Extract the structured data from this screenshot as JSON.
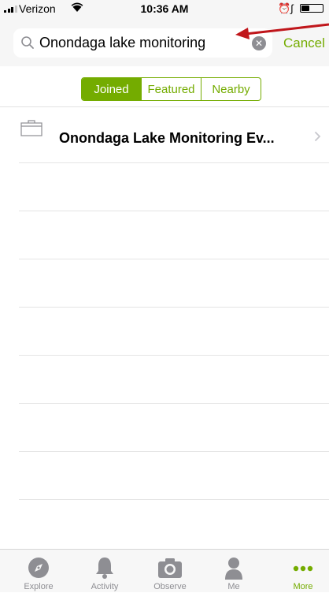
{
  "status_bar": {
    "carrier": "Verizon",
    "time": "10:36 AM",
    "wifi_icon": "wifi-icon",
    "alarm_icon": "alarm-clock-icon",
    "bluetooth_icon": "bluetooth-icon",
    "battery_icon": "battery-icon"
  },
  "search": {
    "value": "Onondaga lake monitoring",
    "placeholder": "Search",
    "cancel_label": "Cancel",
    "clear_icon": "clear-icon",
    "search_icon": "search-icon"
  },
  "filter": {
    "segments": [
      {
        "label": "Joined",
        "active": true
      },
      {
        "label": "Featured",
        "active": false
      },
      {
        "label": "Nearby",
        "active": false
      }
    ]
  },
  "results": [
    {
      "name": "Onondaga Lake Monitoring Ev...",
      "icon": "briefcase-icon"
    }
  ],
  "tab_bar": {
    "tabs": [
      {
        "label": "Explore",
        "icon": "compass-icon",
        "active": false
      },
      {
        "label": "Activity",
        "icon": "bell-icon",
        "active": false
      },
      {
        "label": "Observe",
        "icon": "camera-icon",
        "active": false
      },
      {
        "label": "Me",
        "icon": "person-icon",
        "active": false
      },
      {
        "label": "More",
        "icon": "more-dots-icon",
        "active": true
      }
    ]
  },
  "colors": {
    "accent": "#74ac00",
    "annotation_arrow": "#c0161b",
    "tab_inactive": "#8e8e93"
  }
}
